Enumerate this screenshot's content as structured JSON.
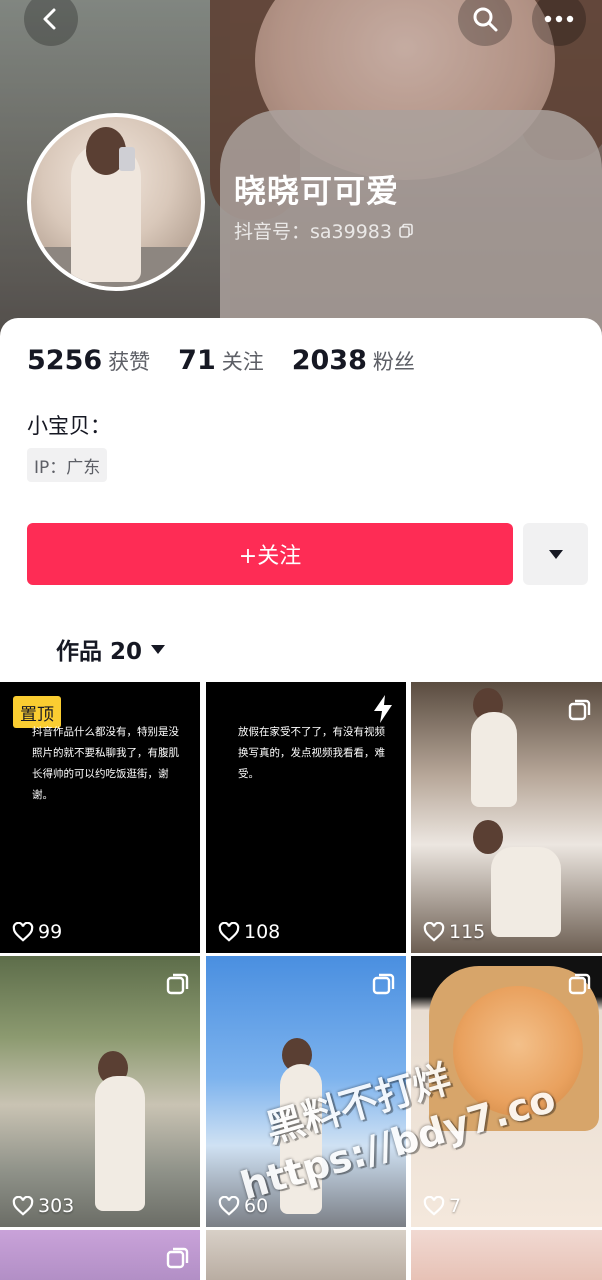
{
  "profile": {
    "nickname": "晓晓可可爱",
    "douyin_id": "抖音号：sa39983",
    "bio": "小宝贝：",
    "ip": "IP：广东"
  },
  "stats": [
    {
      "num": "5256",
      "label": "获赞"
    },
    {
      "num": "71",
      "label": "关注"
    },
    {
      "num": "2038",
      "label": "粉丝"
    }
  ],
  "actions": {
    "follow": "+关注"
  },
  "tabs": {
    "works": "作品 20"
  },
  "grid": [
    {
      "likes": "99",
      "pinned": "置顶",
      "text": "抖音作品什么都没有，特别是没照片的就不要私聊我了，有腹肌长得帅的可以约吃饭逛街，谢谢。"
    },
    {
      "likes": "108",
      "text": "放假在家受不了了，有没有视频换写真的，发点视频我看看，难受。"
    },
    {
      "likes": "115"
    },
    {
      "likes": "303"
    },
    {
      "likes": "60"
    },
    {
      "likes": "7"
    }
  ],
  "watermark": {
    "line1": "黑料不打烊",
    "line2": "https://bdy7.co"
  },
  "colors": {
    "accent": "#fe2c55",
    "pin": "#facd31"
  }
}
